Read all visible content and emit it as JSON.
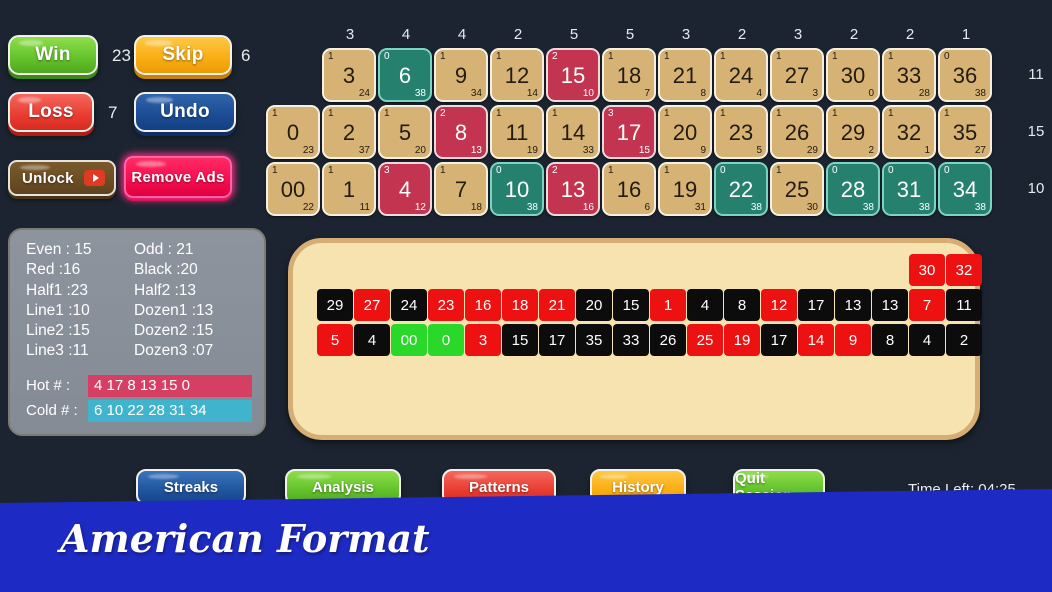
{
  "actions": {
    "win": {
      "label": "Win",
      "count": "23"
    },
    "skip": {
      "label": "Skip",
      "count": "6"
    },
    "loss": {
      "label": "Loss",
      "count": "7"
    },
    "undo": {
      "label": "Undo"
    },
    "unlock": {
      "label": "Unlock",
      "icon": "play-icon"
    },
    "remove_ads": {
      "label": "Remove Ads"
    }
  },
  "stats": {
    "rows": [
      {
        "left": "Even : 15",
        "right": "Odd :  21"
      },
      {
        "left": "Red :16",
        "right": "Black :20"
      },
      {
        "left": "Half1 :23",
        "right": "Half2 :13"
      },
      {
        "left": "Line1 :10",
        "right": "Dozen1 :13"
      },
      {
        "left": "Line2 :15",
        "right": "Dozen2 :15"
      },
      {
        "left": "Line3 :11",
        "right": "Dozen3 :07"
      }
    ],
    "hot": {
      "label": "Hot # :",
      "values": "4 17 8 13 15 0",
      "color": "#d53f63"
    },
    "cold": {
      "label": "Cold # :",
      "values": "6 10 22 28 31 34",
      "color": "#3fb4cc"
    }
  },
  "grid": {
    "column_headers": [
      "3",
      "4",
      "4",
      "2",
      "5",
      "5",
      "3",
      "2",
      "3",
      "2",
      "2",
      "1"
    ],
    "row_totals": [
      "11",
      "15",
      "10"
    ],
    "rows": [
      [
        null,
        {
          "n": "3",
          "tl": "1",
          "br": "24",
          "color": "tan"
        },
        {
          "n": "6",
          "tl": "0",
          "br": "38",
          "color": "teal"
        },
        {
          "n": "9",
          "tl": "1",
          "br": "34",
          "color": "tan"
        },
        {
          "n": "12",
          "tl": "1",
          "br": "14",
          "color": "tan"
        },
        {
          "n": "15",
          "tl": "2",
          "br": "10",
          "color": "red"
        },
        {
          "n": "18",
          "tl": "1",
          "br": "7",
          "color": "tan"
        },
        {
          "n": "21",
          "tl": "1",
          "br": "8",
          "color": "tan"
        },
        {
          "n": "24",
          "tl": "1",
          "br": "4",
          "color": "tan"
        },
        {
          "n": "27",
          "tl": "1",
          "br": "3",
          "color": "tan"
        },
        {
          "n": "30",
          "tl": "1",
          "br": "0",
          "color": "tan"
        },
        {
          "n": "33",
          "tl": "1",
          "br": "28",
          "color": "tan"
        },
        {
          "n": "36",
          "tl": "0",
          "br": "38",
          "color": "tan"
        }
      ],
      [
        {
          "n": "0",
          "tl": "1",
          "br": "23",
          "color": "tan"
        },
        {
          "n": "2",
          "tl": "1",
          "br": "37",
          "color": "tan"
        },
        {
          "n": "5",
          "tl": "1",
          "br": "20",
          "color": "tan"
        },
        {
          "n": "8",
          "tl": "2",
          "br": "13",
          "color": "red"
        },
        {
          "n": "11",
          "tl": "1",
          "br": "19",
          "color": "tan"
        },
        {
          "n": "14",
          "tl": "1",
          "br": "33",
          "color": "tan"
        },
        {
          "n": "17",
          "tl": "3",
          "br": "15",
          "color": "red"
        },
        {
          "n": "20",
          "tl": "1",
          "br": "9",
          "color": "tan"
        },
        {
          "n": "23",
          "tl": "1",
          "br": "5",
          "color": "tan"
        },
        {
          "n": "26",
          "tl": "1",
          "br": "29",
          "color": "tan"
        },
        {
          "n": "29",
          "tl": "1",
          "br": "2",
          "color": "tan"
        },
        {
          "n": "32",
          "tl": "1",
          "br": "1",
          "color": "tan"
        },
        {
          "n": "35",
          "tl": "1",
          "br": "27",
          "color": "tan"
        }
      ],
      [
        {
          "n": "00",
          "tl": "1",
          "br": "22",
          "color": "tan"
        },
        {
          "n": "1",
          "tl": "1",
          "br": "11",
          "color": "tan"
        },
        {
          "n": "4",
          "tl": "3",
          "br": "12",
          "color": "red"
        },
        {
          "n": "7",
          "tl": "1",
          "br": "18",
          "color": "tan"
        },
        {
          "n": "10",
          "tl": "0",
          "br": "38",
          "color": "teal"
        },
        {
          "n": "13",
          "tl": "2",
          "br": "16",
          "color": "red"
        },
        {
          "n": "16",
          "tl": "1",
          "br": "6",
          "color": "tan"
        },
        {
          "n": "19",
          "tl": "1",
          "br": "31",
          "color": "tan"
        },
        {
          "n": "22",
          "tl": "0",
          "br": "38",
          "color": "teal"
        },
        {
          "n": "25",
          "tl": "1",
          "br": "30",
          "color": "tan"
        },
        {
          "n": "28",
          "tl": "0",
          "br": "38",
          "color": "teal"
        },
        {
          "n": "31",
          "tl": "0",
          "br": "38",
          "color": "teal"
        },
        {
          "n": "34",
          "tl": "0",
          "br": "38",
          "color": "teal"
        }
      ]
    ]
  },
  "history": {
    "rows": [
      [
        null,
        null,
        null,
        null,
        null,
        null,
        null,
        null,
        null,
        null,
        null,
        null,
        null,
        null,
        null,
        null,
        {
          "n": "30",
          "color": "red"
        },
        {
          "n": "32",
          "color": "red"
        }
      ],
      [
        {
          "n": "29",
          "color": "black"
        },
        {
          "n": "27",
          "color": "red"
        },
        {
          "n": "24",
          "color": "black"
        },
        {
          "n": "23",
          "color": "red"
        },
        {
          "n": "16",
          "color": "red"
        },
        {
          "n": "18",
          "color": "red"
        },
        {
          "n": "21",
          "color": "red"
        },
        {
          "n": "20",
          "color": "black"
        },
        {
          "n": "15",
          "color": "black"
        },
        {
          "n": "1",
          "color": "red"
        },
        {
          "n": "4",
          "color": "black"
        },
        {
          "n": "8",
          "color": "black"
        },
        {
          "n": "12",
          "color": "red"
        },
        {
          "n": "17",
          "color": "black"
        },
        {
          "n": "13",
          "color": "black"
        },
        {
          "n": "13",
          "color": "black"
        },
        {
          "n": "7",
          "color": "red"
        },
        {
          "n": "11",
          "color": "black"
        }
      ],
      [
        {
          "n": "5",
          "color": "red"
        },
        {
          "n": "4",
          "color": "black"
        },
        {
          "n": "00",
          "color": "green"
        },
        {
          "n": "0",
          "color": "green"
        },
        {
          "n": "3",
          "color": "red"
        },
        {
          "n": "15",
          "color": "black"
        },
        {
          "n": "17",
          "color": "black"
        },
        {
          "n": "35",
          "color": "black"
        },
        {
          "n": "33",
          "color": "black"
        },
        {
          "n": "26",
          "color": "black"
        },
        {
          "n": "25",
          "color": "red"
        },
        {
          "n": "19",
          "color": "red"
        },
        {
          "n": "17",
          "color": "black"
        },
        {
          "n": "14",
          "color": "red"
        },
        {
          "n": "9",
          "color": "red"
        },
        {
          "n": "8",
          "color": "black"
        },
        {
          "n": "4",
          "color": "black"
        },
        {
          "n": "2",
          "color": "black"
        }
      ]
    ]
  },
  "bottom_buttons": [
    {
      "label": "Streaks",
      "name": "streaks"
    },
    {
      "label": "Analysis",
      "name": "analysis"
    },
    {
      "label": "Patterns",
      "name": "patterns"
    },
    {
      "label": "History",
      "name": "history"
    },
    {
      "label": "Quit Session",
      "name": "quit-session"
    }
  ],
  "time_left": "Time Left: 04:25",
  "banner": {
    "title": "American Format",
    "color": "#1d2bc4"
  }
}
